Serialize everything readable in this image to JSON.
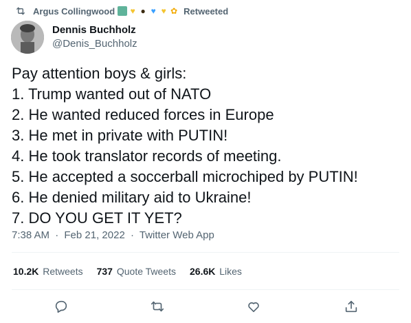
{
  "retweet_bar": {
    "user": "Argus Collingwood",
    "label": "Retweeted",
    "emoji_icons": [
      "statue-of-liberty-icon",
      "yellow-heart-icon",
      "bee-icon",
      "blue-heart-icon",
      "yellow-heart-icon",
      "sunflower-icon"
    ]
  },
  "author": {
    "display_name": "Dennis Buchholz",
    "handle": "@Denis_Buchholz",
    "avatar_icon": "avatar-photo"
  },
  "tweet": {
    "lines": [
      "Pay attention boys & girls:",
      "1. Trump wanted out of NATO",
      "2. He wanted reduced forces in Europe",
      "3. He met in private with PUTIN!",
      "4. He took translator records of meeting.",
      "5. He accepted a soccerball microchiped by PUTIN!",
      "6. He denied military aid to Ukraine!",
      "7. DO YOU GET IT YET?"
    ]
  },
  "meta": {
    "time": "7:38 AM",
    "date": "Feb 21, 2022",
    "source": "Twitter Web App",
    "separator": "·"
  },
  "stats": {
    "retweets_count": "10.2K",
    "retweets_label": "Retweets",
    "quotes_count": "737",
    "quotes_label": "Quote Tweets",
    "likes_count": "26.6K",
    "likes_label": "Likes"
  },
  "actions": [
    "reply-icon",
    "retweet-icon",
    "like-icon",
    "share-icon"
  ],
  "colors": {
    "text": "#0f1419",
    "secondary": "#536471",
    "divider": "#eff3f4"
  }
}
